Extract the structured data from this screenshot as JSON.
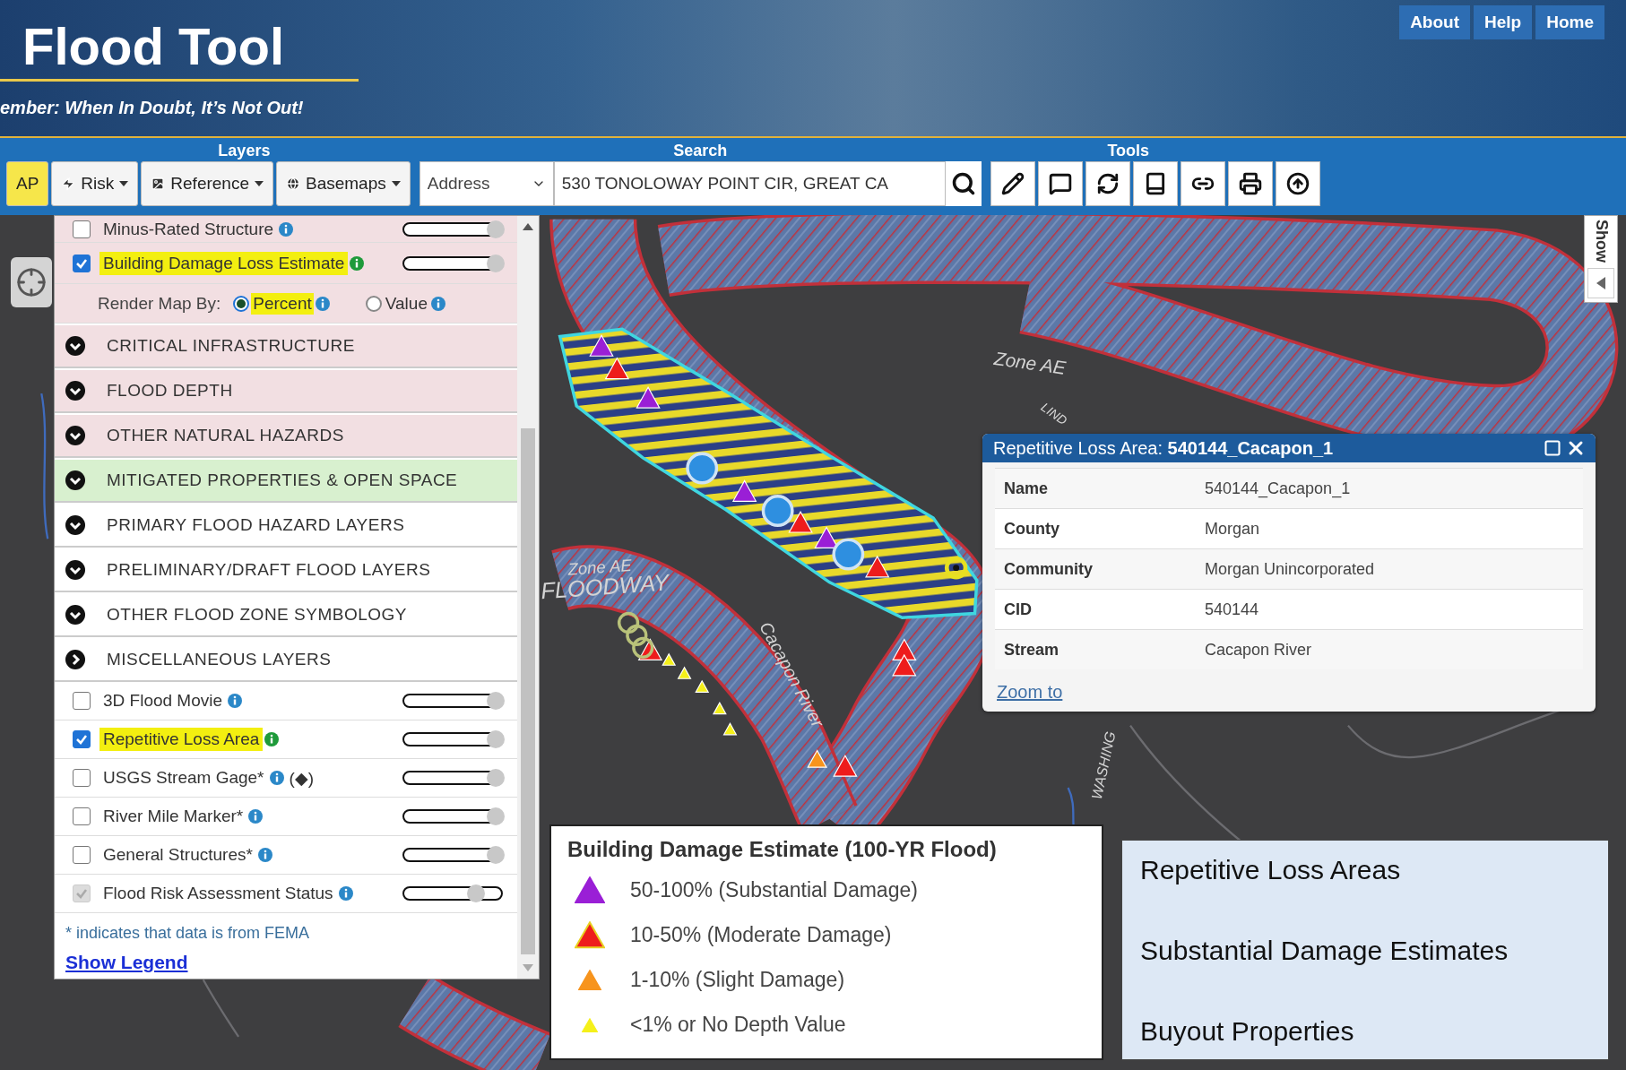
{
  "header": {
    "title": "Flood Tool",
    "tagline": "ember: When In Doubt, It’s Not Out!",
    "links": [
      "About",
      "Help",
      "Home"
    ]
  },
  "toolbar": {
    "groups": [
      "Layers",
      "Search",
      "Tools"
    ],
    "layer_buttons": [
      {
        "label": "AP",
        "selected": true,
        "dropdown": false
      },
      {
        "label": "Risk",
        "selected": false,
        "dropdown": true
      },
      {
        "label": "Reference",
        "selected": false,
        "dropdown": true
      },
      {
        "label": "Basemaps",
        "selected": false,
        "dropdown": true
      }
    ],
    "search_type": "Address",
    "search_value": "530 TONOLOWAY POINT CIR, GREAT CA"
  },
  "panel": {
    "rows": [
      {
        "kind": "layer",
        "label": "Minus-Rated Structure",
        "checked": false,
        "disabled": false,
        "highlighted": false,
        "level": 1,
        "color": "#f2dfe2"
      },
      {
        "kind": "layer",
        "label": "Building Damage Loss Estimate",
        "checked": true,
        "disabled": false,
        "highlighted": true,
        "level": 1,
        "color": "#f2dfe2"
      },
      {
        "kind": "render",
        "label": "Render Map By:",
        "color": "#f2dfe2",
        "options": [
          {
            "label": "Percent",
            "selected": true,
            "highlighted": true
          },
          {
            "label": "Value",
            "selected": false,
            "highlighted": false
          }
        ]
      },
      {
        "kind": "section",
        "label": "CRITICAL INFRASTRUCTURE",
        "expanded": false,
        "color": "#f2dfe2"
      },
      {
        "kind": "section",
        "label": "FLOOD DEPTH",
        "expanded": false,
        "color": "#f2dfe2"
      },
      {
        "kind": "section",
        "label": "OTHER NATURAL HAZARDS",
        "expanded": false,
        "color": "#f2dfe2"
      },
      {
        "kind": "section",
        "label": "MITIGATED PROPERTIES & OPEN SPACE",
        "expanded": false,
        "color": "#d8f0cf"
      },
      {
        "kind": "section",
        "label": "PRIMARY FLOOD HAZARD LAYERS",
        "expanded": false,
        "color": "#ffffff"
      },
      {
        "kind": "section",
        "label": "PRELIMINARY/DRAFT FLOOD LAYERS",
        "expanded": false,
        "color": "#ffffff"
      },
      {
        "kind": "section",
        "label": "OTHER FLOOD ZONE SYMBOLOGY",
        "expanded": false,
        "color": "#ffffff"
      },
      {
        "kind": "section",
        "label": "MISCELLANEOUS LAYERS",
        "expanded": true,
        "color": "#ffffff"
      },
      {
        "kind": "layer",
        "label": "3D Flood Movie",
        "checked": false,
        "disabled": false,
        "highlighted": false,
        "level": 1,
        "color": "#ffffff"
      },
      {
        "kind": "layer",
        "label": "Repetitive Loss Area",
        "checked": true,
        "disabled": false,
        "highlighted": true,
        "level": 1,
        "color": "#ffffff"
      },
      {
        "kind": "layer",
        "label": "USGS Stream Gage*",
        "suffix": "(◆)",
        "checked": false,
        "disabled": false,
        "highlighted": false,
        "level": 1,
        "color": "#ffffff"
      },
      {
        "kind": "layer",
        "label": "River Mile Marker*",
        "checked": false,
        "disabled": false,
        "highlighted": false,
        "level": 1,
        "color": "#ffffff"
      },
      {
        "kind": "layer",
        "label": "General Structures*",
        "checked": false,
        "disabled": false,
        "highlighted": false,
        "level": 1,
        "color": "#ffffff"
      },
      {
        "kind": "layer",
        "label": "Flood Risk Assessment Status",
        "checked": true,
        "disabled": true,
        "highlighted": false,
        "level": 0.78,
        "color": "#ffffff"
      }
    ],
    "note": "* indicates that data is from FEMA",
    "legend_link": "Show Legend"
  },
  "map": {
    "labels": [
      "Zone AE",
      "LIND",
      "Zone AE",
      "FLOODWAY",
      "Cacapon River",
      "WASHING"
    ]
  },
  "side_tab": {
    "label": "Show"
  },
  "popup": {
    "title": "Repetitive Loss Area: **540144_Cacapon_1**",
    "rows": [
      {
        "label": "Name",
        "value": "540144_Cacapon_1"
      },
      {
        "label": "County",
        "value": "Morgan"
      },
      {
        "label": "Community",
        "value": "Morgan Unincorporated"
      },
      {
        "label": "CID",
        "value": "540144"
      },
      {
        "label": "Stream",
        "value": "Cacapon River"
      }
    ],
    "link": "Zoom to"
  },
  "legend": {
    "title": "Building Damage Estimate (100-YR Flood)",
    "items": [
      {
        "label": "50-100% (Substantial Damage)",
        "color": "#9a1fd6",
        "kind": "large"
      },
      {
        "label": "10-50% (Moderate Damage)",
        "color": "#ee1c1c",
        "kind": "large"
      },
      {
        "label": "1-10% (Slight Damage)",
        "color": "#f7941d",
        "kind": "medium"
      },
      {
        "label": "<1% or No Depth Value",
        "color": "#f5f01a",
        "kind": "small"
      }
    ]
  },
  "annotation": {
    "lines": [
      "Repetitive Loss Areas",
      "Substantial Damage Estimates",
      "Buyout Properties"
    ]
  }
}
